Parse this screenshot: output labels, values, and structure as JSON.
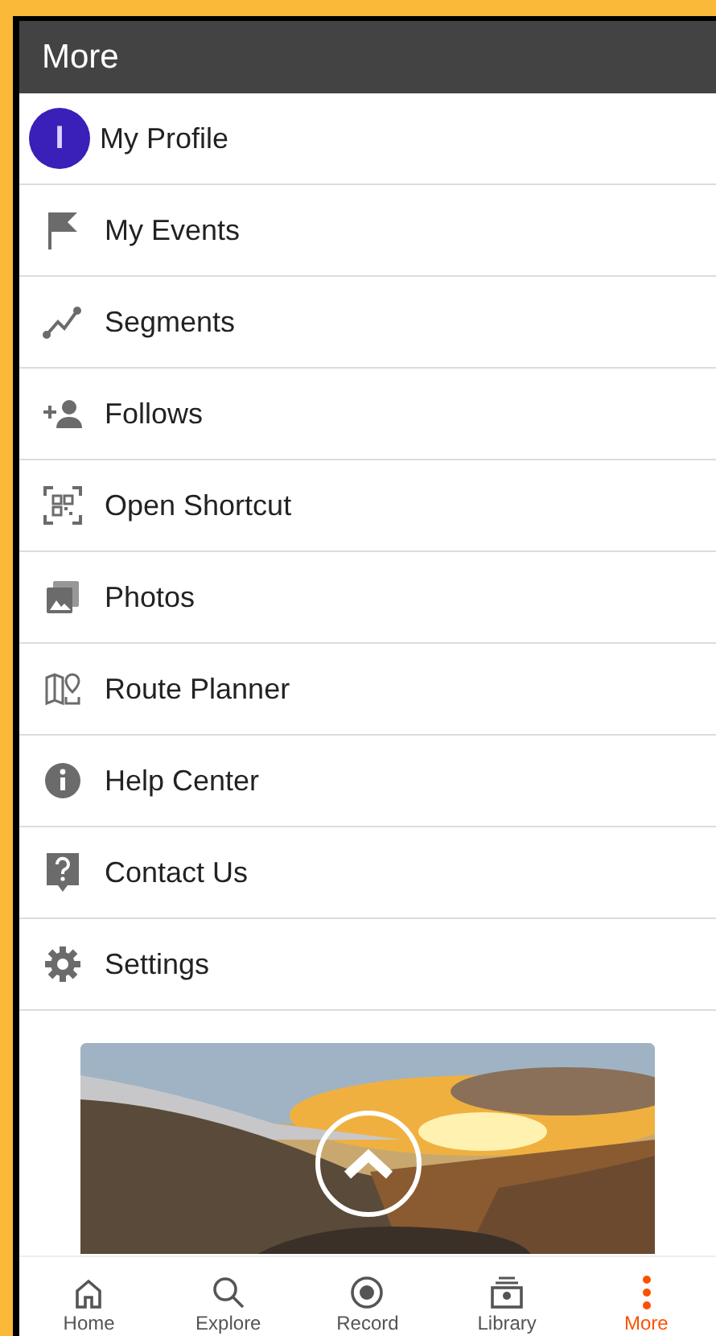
{
  "header": {
    "title": "More"
  },
  "menu": [
    {
      "label": "My Profile",
      "avatar_text": "I"
    },
    {
      "label": "My Events"
    },
    {
      "label": "Segments"
    },
    {
      "label": "Follows"
    },
    {
      "label": "Open Shortcut"
    },
    {
      "label": "Photos"
    },
    {
      "label": "Route Planner"
    },
    {
      "label": "Help Center"
    },
    {
      "label": "Contact Us"
    },
    {
      "label": "Settings"
    }
  ],
  "bottom_nav": [
    {
      "label": "Home",
      "selected": false
    },
    {
      "label": "Explore",
      "selected": false
    },
    {
      "label": "Record",
      "selected": false
    },
    {
      "label": "Library",
      "selected": false
    },
    {
      "label": "More",
      "selected": true
    }
  ]
}
